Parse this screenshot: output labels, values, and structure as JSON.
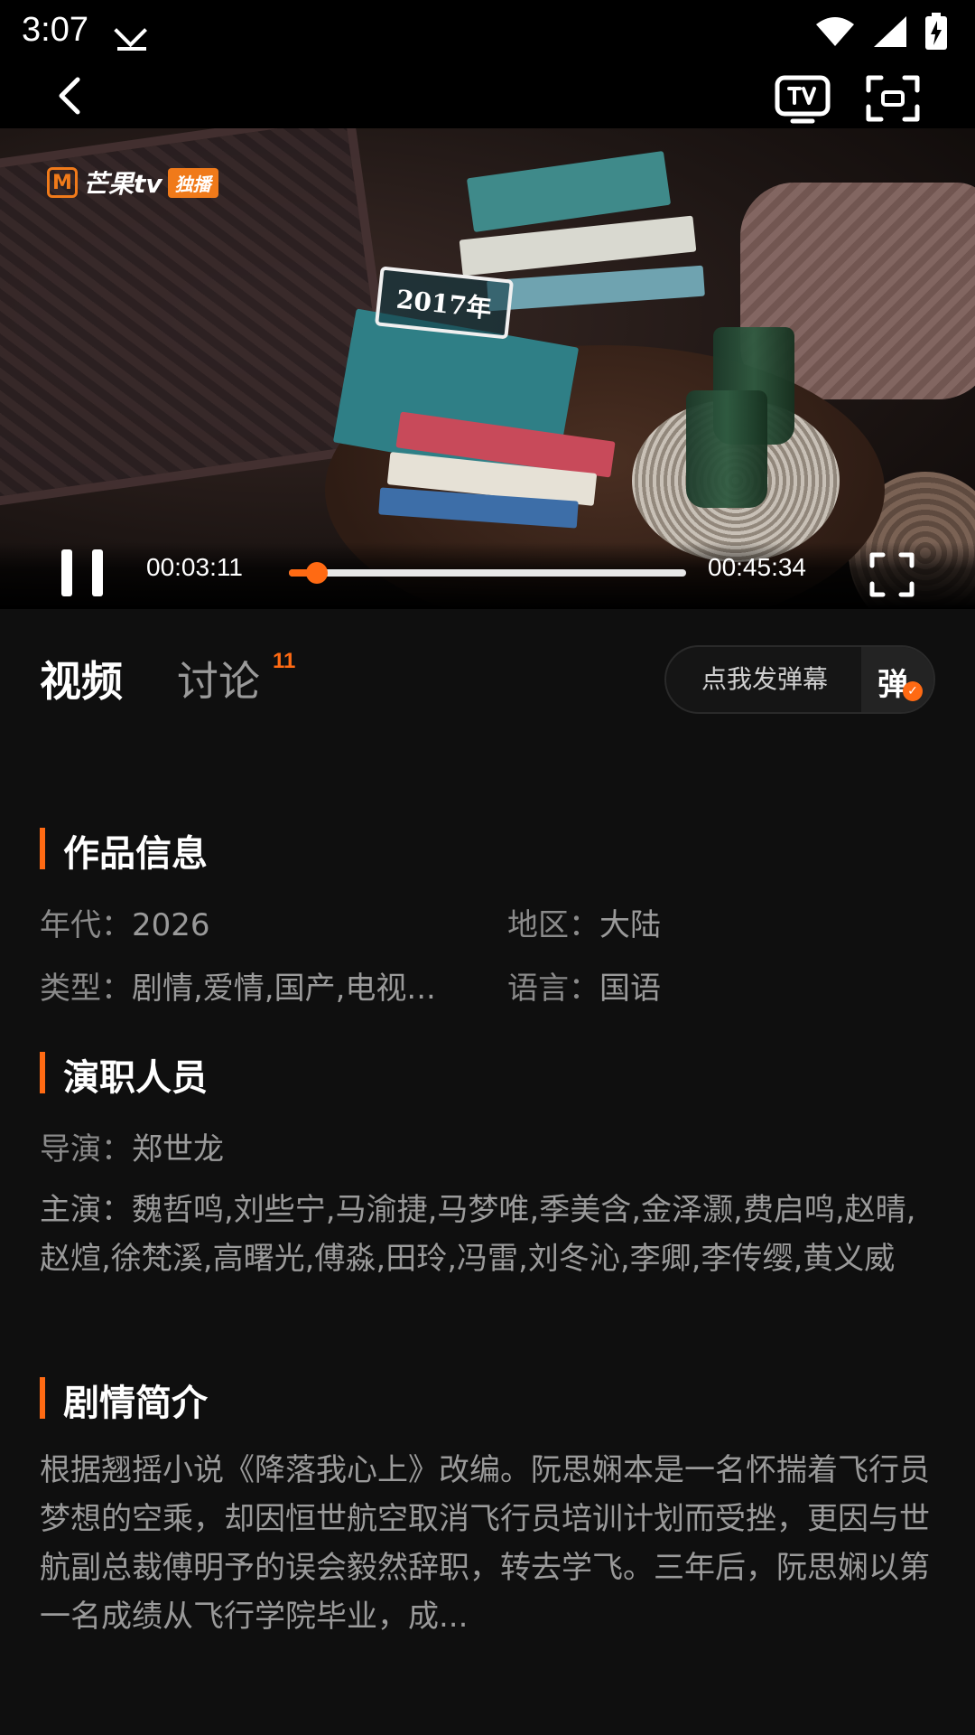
{
  "status_bar": {
    "time": "3:07",
    "icons": [
      "download-done-icon",
      "wifi-icon",
      "signal-icon",
      "battery-charging-icon"
    ]
  },
  "top_bar": {
    "icons": [
      "back-icon",
      "tv-cast-icon",
      "scan-icon"
    ]
  },
  "video": {
    "logo_text": "芒果tv",
    "logo_tag": "独播",
    "book_label": "2017年",
    "current_time": "00:03:11",
    "total_time": "00:45:34",
    "progress_fraction": 0.07
  },
  "tabs": {
    "video_label": "视频",
    "discuss_label": "讨论",
    "discuss_count": "11",
    "danmu_placeholder": "点我发弹幕",
    "danmu_toggle_char": "弹"
  },
  "info": {
    "title": "作品信息",
    "year_label": "年代：",
    "year_value": "2026",
    "region_label": "地区：",
    "region_value": "大陆",
    "genre_label": "类型：",
    "genre_value": "剧情,爱情,国产,电视...",
    "language_label": "语言：",
    "language_value": "国语"
  },
  "cast": {
    "title": "演职人员",
    "director_label": "导演：",
    "director_value": "郑世龙",
    "actors_label": "主演：",
    "actors_value": "魏哲鸣,刘些宁,马渝捷,马梦唯,季美含,金泽灏,费启鸣,赵晴,赵煊,徐梵溪,高曙光,傅淼,田玲,冯雷,刘冬沁,李卿,李传缨,黄义威"
  },
  "synopsis": {
    "title": "剧情简介",
    "text": "根据翘摇小说《降落我心上》改编。阮思娴本是一名怀揣着飞行员梦想的空乘，却因恒世航空取消飞行员培训计划而受挫，更因与世航副总裁傅明予的误会毅然辞职，转去学飞。三年后，阮思娴以第一名成绩从飞行学院毕业，成..."
  },
  "colors": {
    "accent": "#ff6a13",
    "background": "#0f0f0f"
  }
}
